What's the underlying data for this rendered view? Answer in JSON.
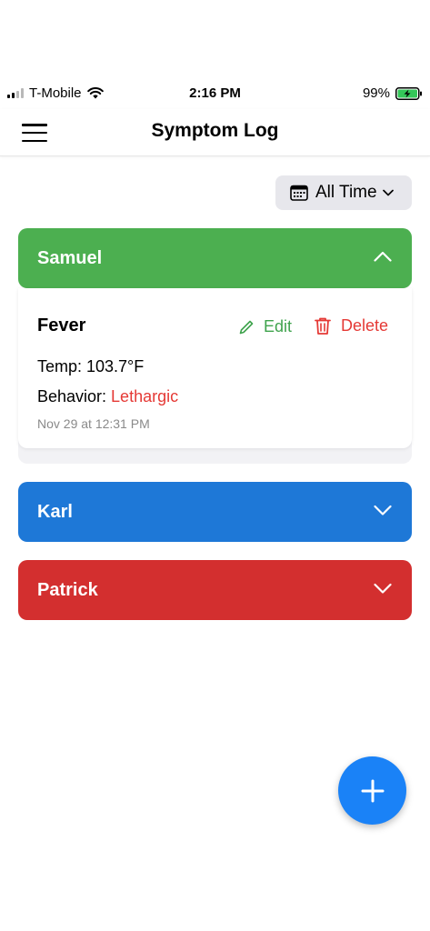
{
  "status_bar": {
    "carrier": "T-Mobile",
    "time": "2:16 PM",
    "battery": "99%"
  },
  "header": {
    "title": "Symptom Log",
    "menu_icon": "hamburger-menu-icon"
  },
  "filter": {
    "icon": "calendar-icon",
    "label": "All Time"
  },
  "patients": [
    {
      "name": "Samuel",
      "color": "#4caf50",
      "expanded": true
    },
    {
      "name": "Karl",
      "color": "#1e78d7",
      "expanded": false
    },
    {
      "name": "Patrick",
      "color": "#d32f2f",
      "expanded": false
    }
  ],
  "entry": {
    "title": "Fever",
    "edit_label": "Edit",
    "delete_label": "Delete",
    "temp": "Temp: 103.7°F",
    "behavior_label": "Behavior: ",
    "behavior_value": "Lethargic",
    "timestamp": "Nov 29 at 12:31 PM"
  },
  "fab": {
    "icon": "plus-icon"
  },
  "colors": {
    "accent_green": "#3fa34d",
    "delete_red": "#e53935",
    "fab_blue": "#1a82f7"
  }
}
